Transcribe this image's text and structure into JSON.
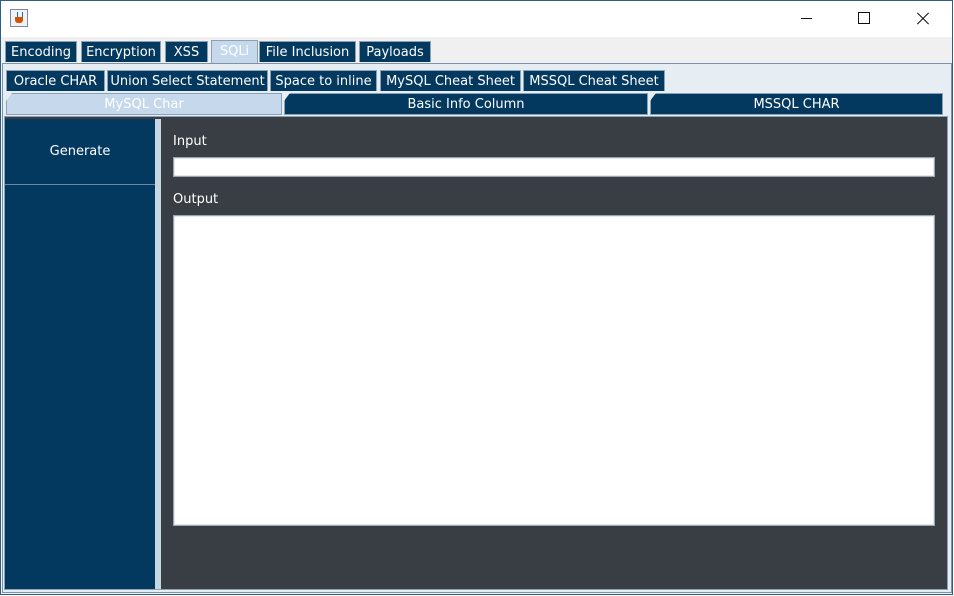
{
  "title_bar": {
    "app_icon": "java-cup-icon",
    "minimize_icon": "minimize-icon",
    "maximize_icon": "maximize-icon",
    "close_icon": "close-icon"
  },
  "top_tabs": [
    {
      "label": "Encoding",
      "selected": false
    },
    {
      "label": "Encryption",
      "selected": false
    },
    {
      "label": "XSS",
      "selected": false
    },
    {
      "label": "SQLi",
      "selected": true
    },
    {
      "label": "File Inclusion",
      "selected": false
    },
    {
      "label": "Payloads",
      "selected": false
    }
  ],
  "sqli_tabs_row1": [
    {
      "label": "Oracle CHAR"
    },
    {
      "label": "Union Select Statement"
    },
    {
      "label": "Space to inline"
    },
    {
      "label": "MySQL Cheat Sheet"
    },
    {
      "label": "MSSQL Cheat Sheet"
    }
  ],
  "sqli_tabs_row2": [
    {
      "label": "MySQL Char",
      "selected": true
    },
    {
      "label": "Basic Info Column",
      "selected": false
    },
    {
      "label": "MSSQL CHAR",
      "selected": false
    }
  ],
  "sidebar": {
    "generate_label": "Generate"
  },
  "form": {
    "input_label": "Input",
    "input_value": "",
    "output_label": "Output",
    "output_value": ""
  },
  "colors": {
    "tab_background": "#03385f",
    "tab_selected": "#c6d9ec",
    "content_background": "#383e44",
    "sidebar_background": "#03385f"
  }
}
